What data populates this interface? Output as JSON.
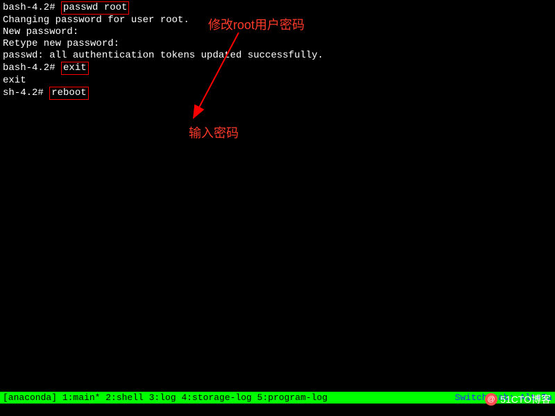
{
  "terminal": {
    "lines": [
      {
        "prompt": "bash-4.2# ",
        "cmd": "passwd root",
        "boxed": true
      },
      {
        "text": "Changing password for user root."
      },
      {
        "text": "New password:"
      },
      {
        "text": "Retype new password:"
      },
      {
        "text": "passwd: all authentication tokens updated successfully."
      },
      {
        "prompt": "bash-4.2# ",
        "cmd": "exit",
        "boxed": true
      },
      {
        "text": "exit"
      },
      {
        "prompt": "sh-4.2# ",
        "cmd": "reboot",
        "boxed": true
      }
    ]
  },
  "annotations": {
    "top": "修改root用户密码",
    "mid": "输入密码"
  },
  "statusbar": {
    "left": "[anaconda] 1:main* 2:shell  3:log  4:storage-log  5:program-log",
    "right": "Switch tab: Alt+Ta"
  },
  "watermark": {
    "icon": "@",
    "text": "51CTO博客"
  }
}
